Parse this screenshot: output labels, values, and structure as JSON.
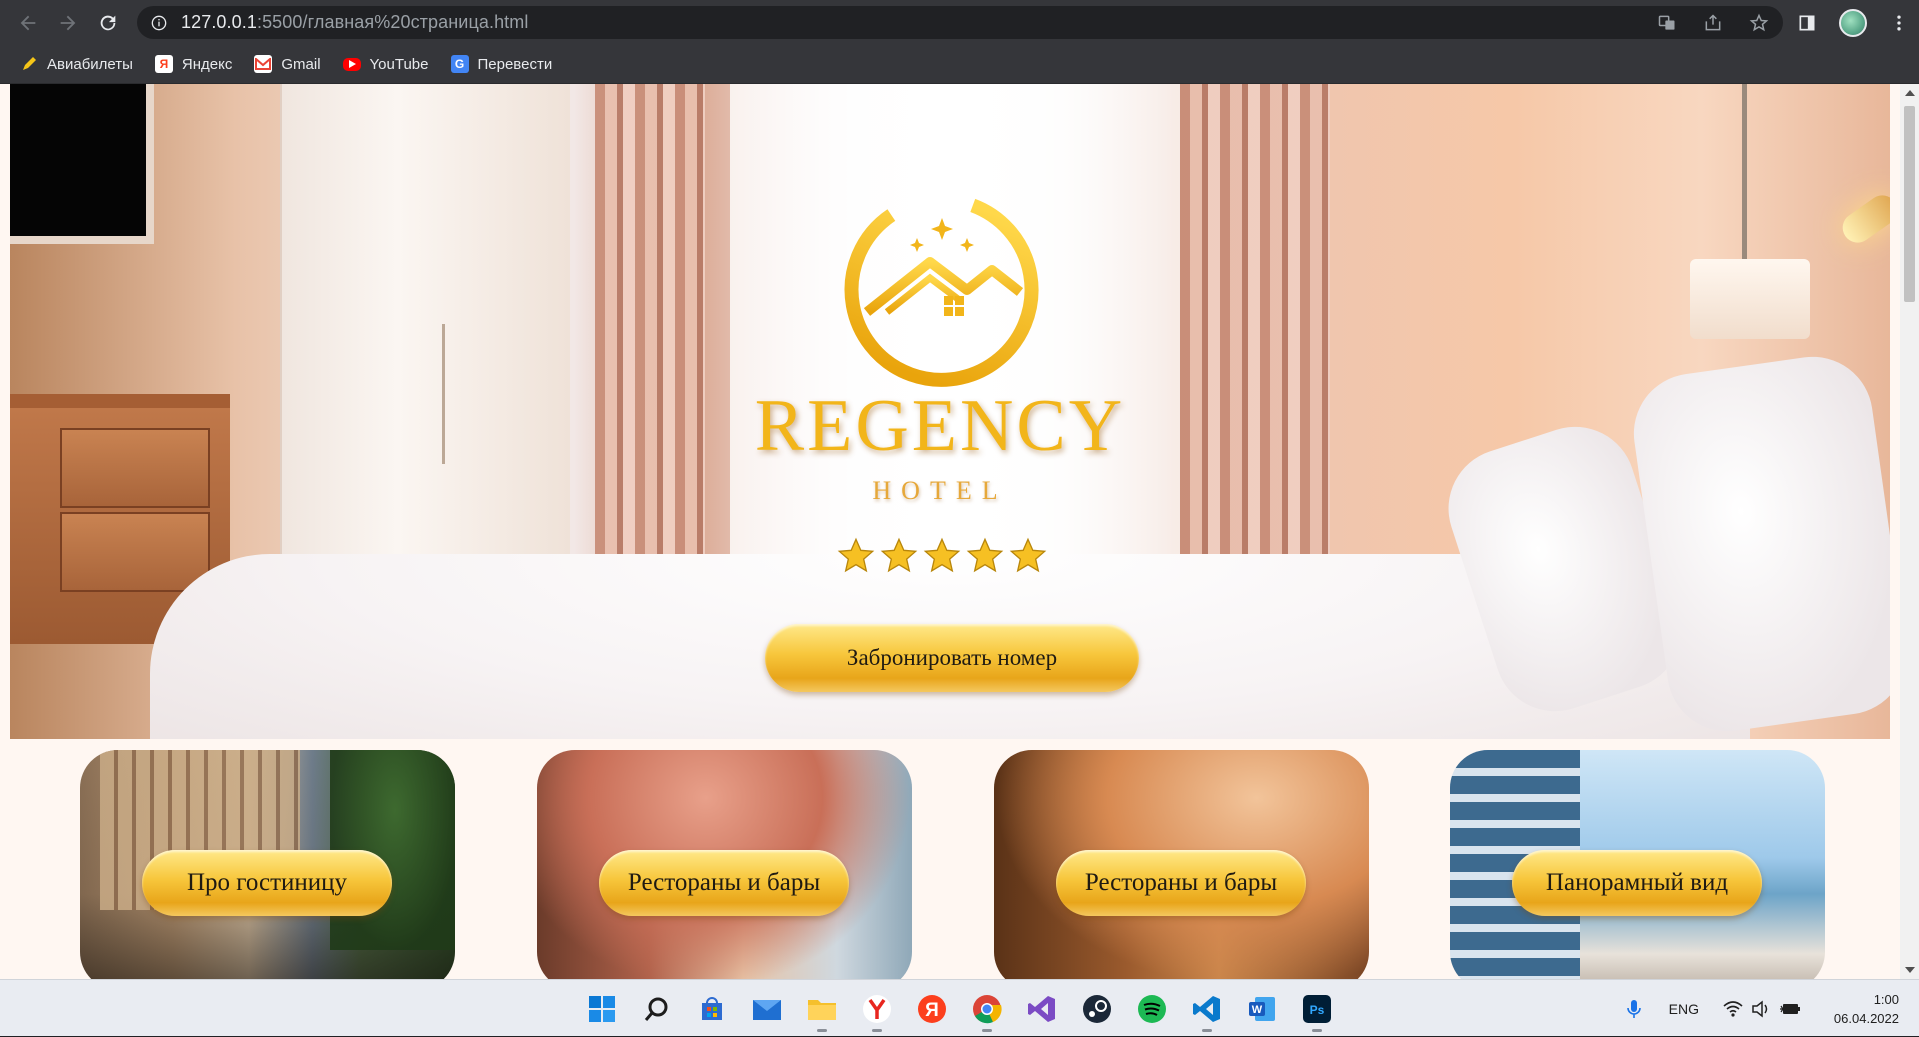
{
  "browser": {
    "url_host": "127.0.0.1",
    "url_rest": ":5500/главная%20страница.html",
    "bookmarks": [
      {
        "label": "Авиабилеты",
        "icon": "pencil-icon"
      },
      {
        "label": "Яндекс",
        "icon": "yandex-icon"
      },
      {
        "label": "Gmail",
        "icon": "gmail-icon"
      },
      {
        "label": "YouTube",
        "icon": "youtube-icon"
      },
      {
        "label": "Перевести",
        "icon": "google-translate-icon"
      }
    ]
  },
  "hero": {
    "brand": "REGENCY",
    "brand_sub": "HOTEL",
    "rating_stars": 5,
    "book_button": "Забронировать номер"
  },
  "cards": [
    {
      "label": "Про гостиницу"
    },
    {
      "label": "Рестораны и бары"
    },
    {
      "label": "Рестораны и бары"
    },
    {
      "label": "Панорамный вид"
    }
  ],
  "taskbar": {
    "language": "ENG",
    "time": "1:00",
    "date": "06.04.2022"
  },
  "colors": {
    "gold": "#f2b51a",
    "chrome_bg": "#35363a"
  }
}
